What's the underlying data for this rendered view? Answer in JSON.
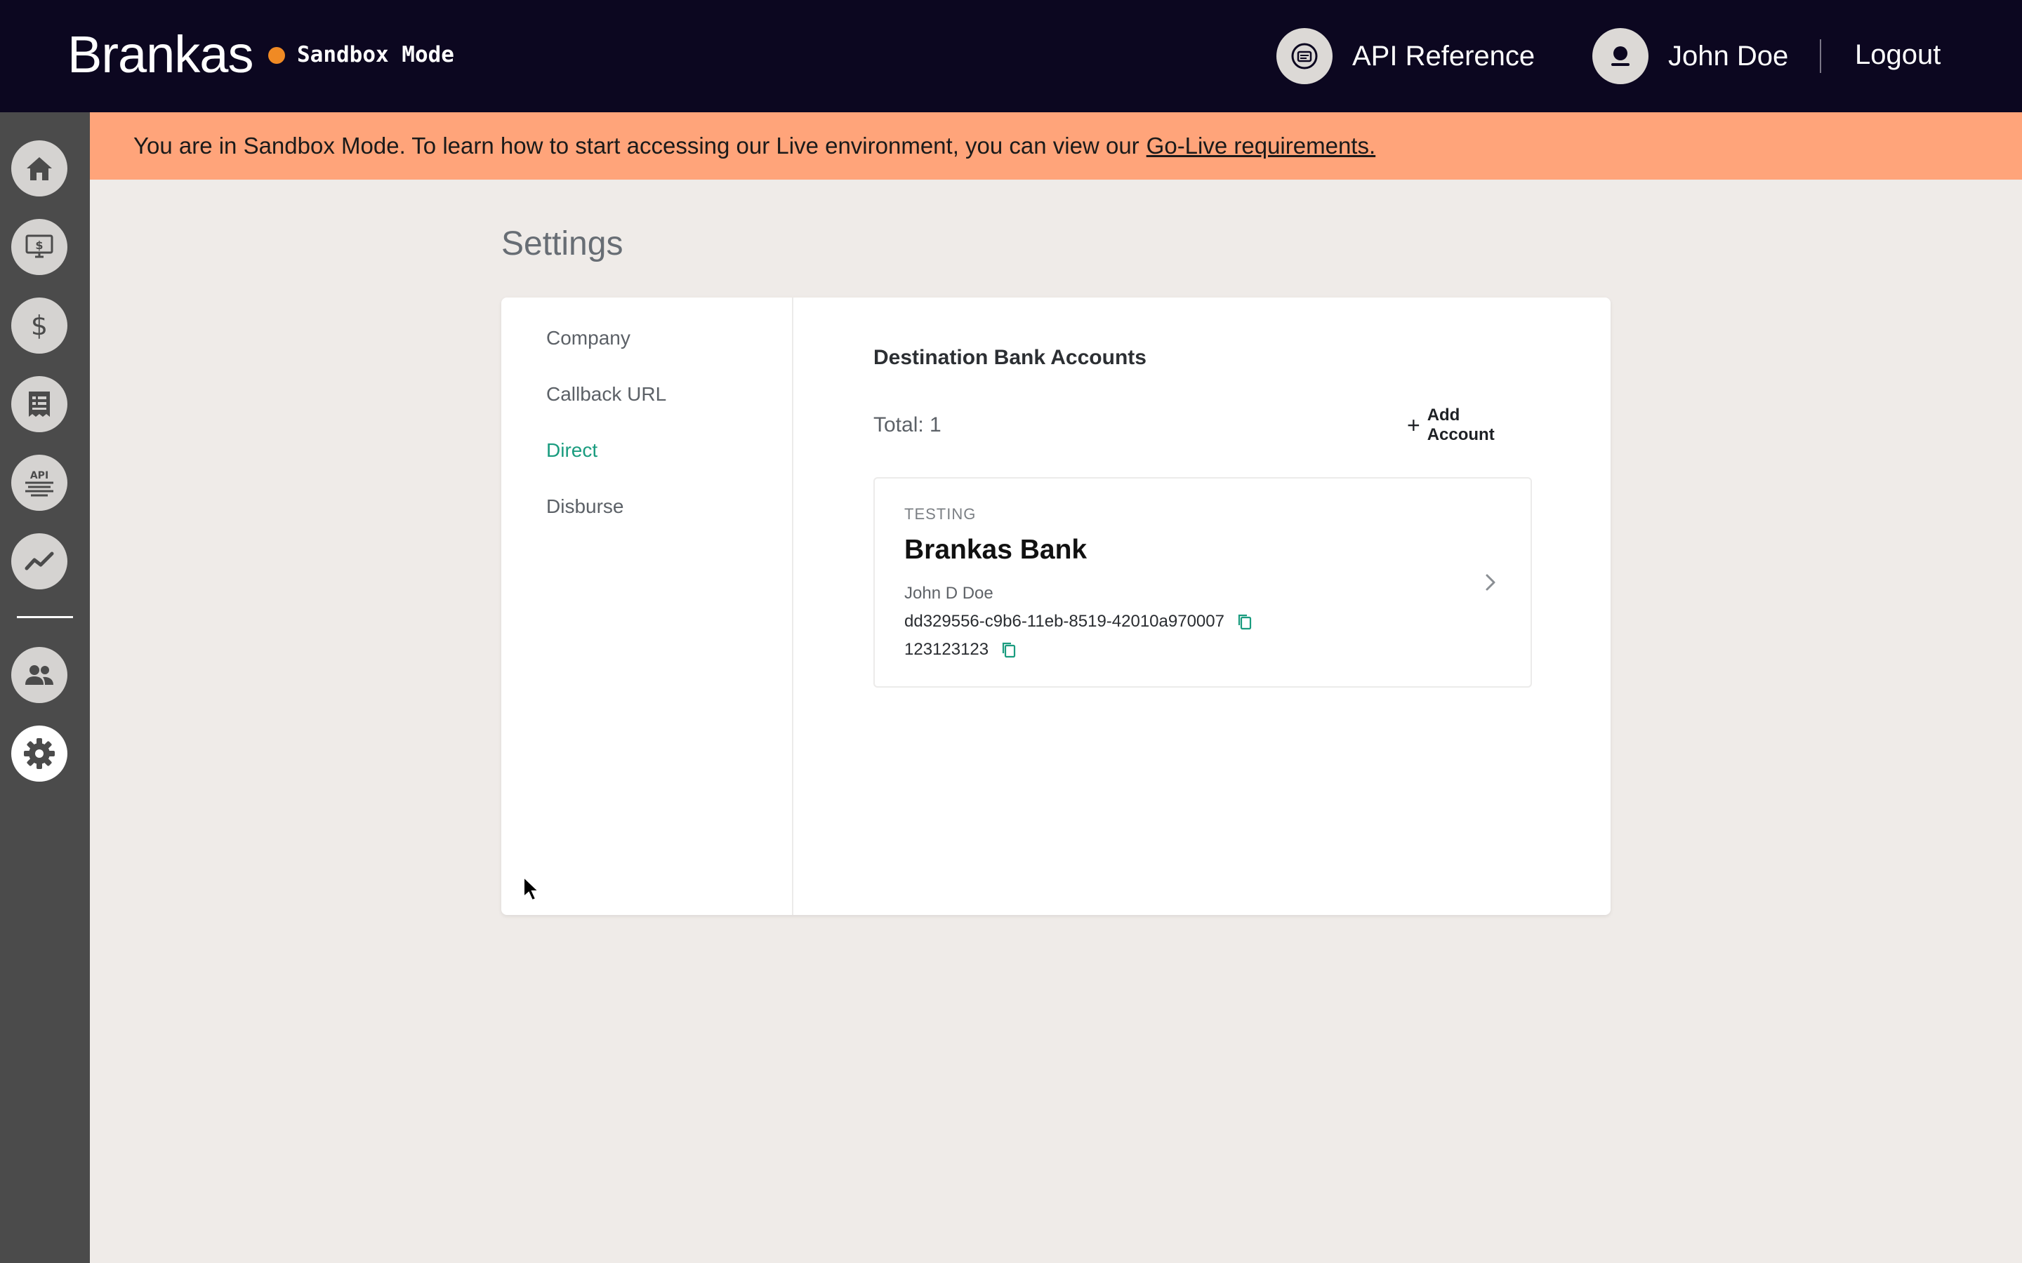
{
  "header": {
    "brand": "Brankas",
    "mode_label": "Sandbox Mode",
    "api_reference_label": "API Reference",
    "user_name": "John Doe",
    "logout_label": "Logout"
  },
  "banner": {
    "text": "You are in Sandbox Mode. To learn how to start accessing our Live environment, you can view our",
    "link_text": "Go-Live requirements."
  },
  "sidebar": {
    "icons": [
      "home-icon",
      "monitor-dollar-icon",
      "dollar-icon",
      "receipt-icon",
      "api-icon",
      "analytics-icon",
      "users-icon",
      "settings-icon"
    ],
    "active": "settings-icon"
  },
  "page": {
    "title": "Settings"
  },
  "settings_nav": {
    "items": [
      {
        "label": "Company"
      },
      {
        "label": "Callback URL"
      },
      {
        "label": "Direct"
      },
      {
        "label": "Disburse"
      }
    ],
    "active": "Direct"
  },
  "destination": {
    "title": "Destination Bank Accounts",
    "total_label": "Total: 1",
    "add_account_label": "Add Account",
    "accounts": [
      {
        "tag": "TESTING",
        "bank_name": "Brankas Bank",
        "holder": "John D Doe",
        "account_id": "dd329556-c9b6-11eb-8519-42010a970007",
        "account_number": "123123123"
      }
    ]
  },
  "colors": {
    "topbar": "#0c0720",
    "sandbox_dot": "#f08a24",
    "banner": "#ffa47a",
    "active_nav": "#1a9c7f",
    "rail": "#4b4b4b",
    "background": "#efebe8"
  }
}
